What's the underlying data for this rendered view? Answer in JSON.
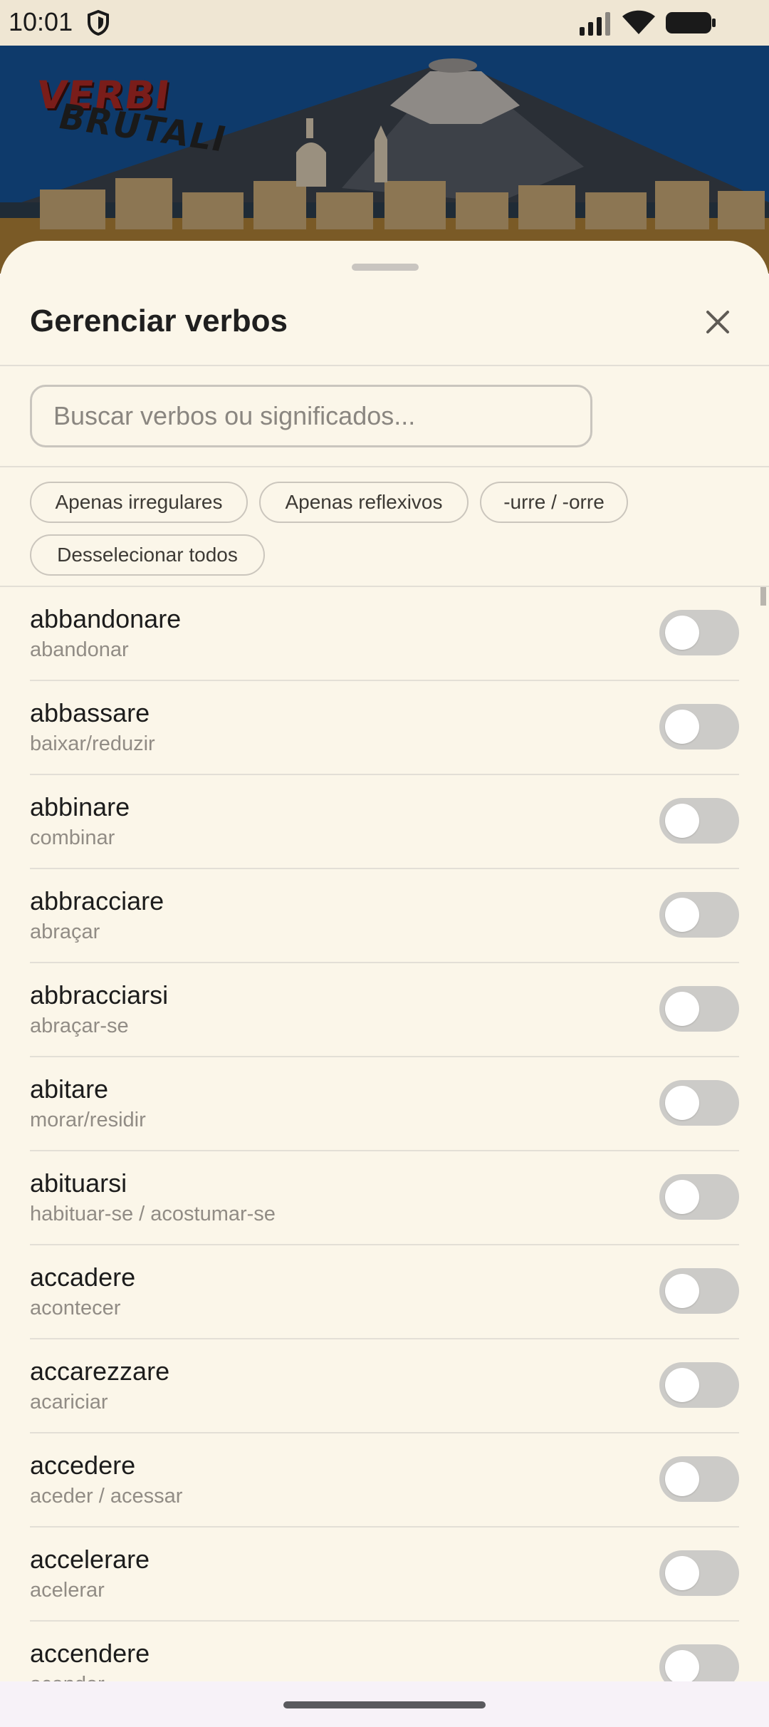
{
  "status_bar": {
    "time": "10:01"
  },
  "header": {
    "logo_main": "VERBI",
    "logo_sub": "BRUTALI"
  },
  "sheet": {
    "title": "Gerenciar verbos",
    "search_placeholder": "Buscar verbos ou significados...",
    "filters": [
      "Apenas irregulares",
      "Apenas reflexivos",
      "-urre / -orre",
      "Desselecionar todos"
    ],
    "verbs": [
      {
        "verb": "abbandonare",
        "meaning": "abandonar",
        "enabled": false
      },
      {
        "verb": "abbassare",
        "meaning": "baixar/reduzir",
        "enabled": false
      },
      {
        "verb": "abbinare",
        "meaning": "combinar",
        "enabled": false
      },
      {
        "verb": "abbracciare",
        "meaning": "abraçar",
        "enabled": false
      },
      {
        "verb": "abbracciarsi",
        "meaning": "abraçar-se",
        "enabled": false
      },
      {
        "verb": "abitare",
        "meaning": "morar/residir",
        "enabled": false
      },
      {
        "verb": "abituarsi",
        "meaning": "habituar-se / acostumar-se",
        "enabled": false
      },
      {
        "verb": "accadere",
        "meaning": "acontecer",
        "enabled": false
      },
      {
        "verb": "accarezzare",
        "meaning": "acariciar",
        "enabled": false
      },
      {
        "verb": "accedere",
        "meaning": "aceder / acessar",
        "enabled": false
      },
      {
        "verb": "accelerare",
        "meaning": "acelerar",
        "enabled": false
      },
      {
        "verb": "accendere",
        "meaning": "acender",
        "enabled": false
      }
    ]
  },
  "colors": {
    "sheet_bg": "#fbf6e9",
    "toggle_off": "#cccbc8",
    "header_sky": "#0e3a6b"
  }
}
